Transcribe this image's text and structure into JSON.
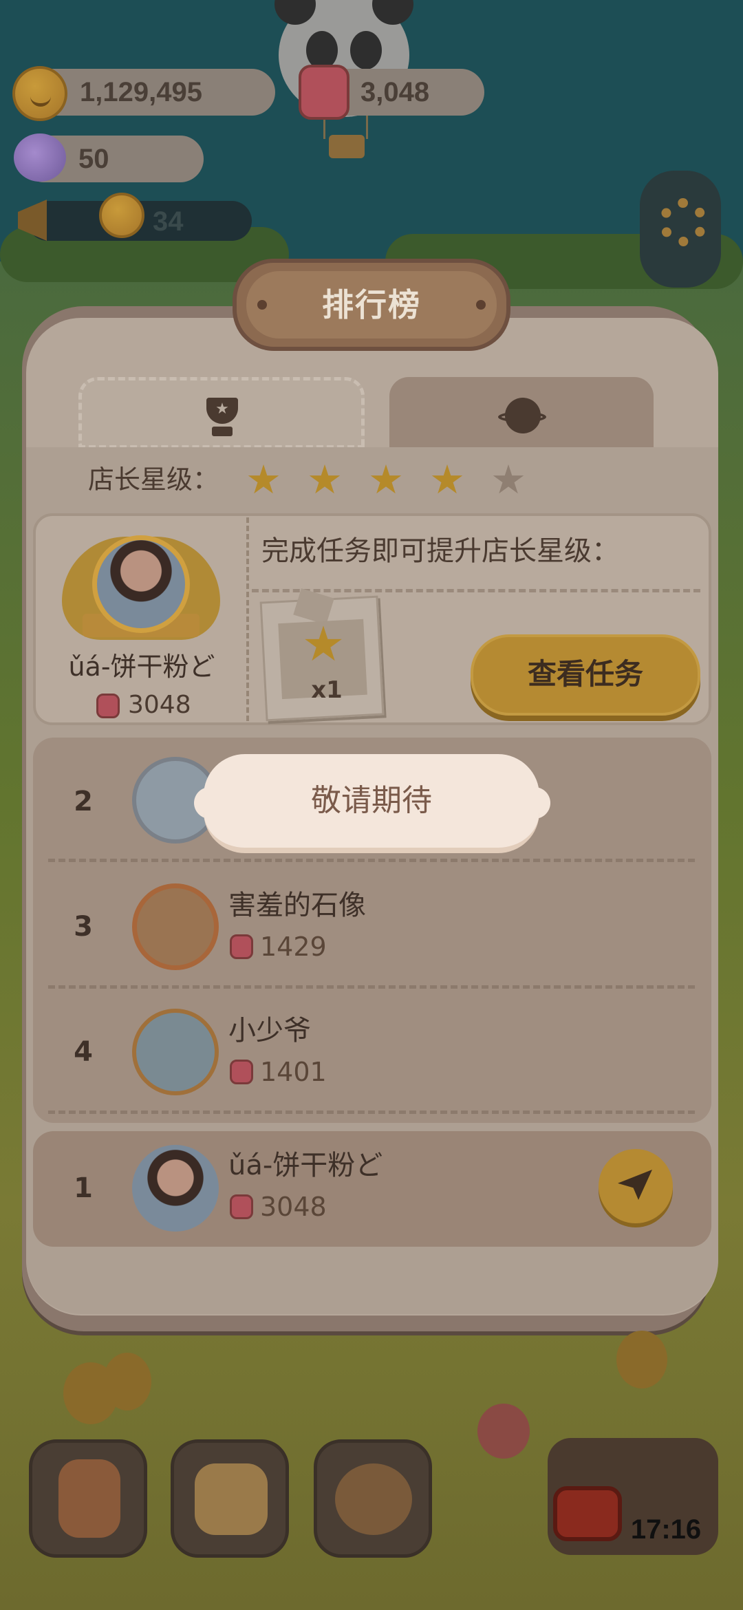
{
  "hud": {
    "coins": "1,129,495",
    "jam": "3,048",
    "candy": "50",
    "helpers": "34",
    "icons": [
      "cookie-coin-icon",
      "jam-jar-icon",
      "candy-icon",
      "megaphone-icon",
      "gear-icon"
    ]
  },
  "dialog": {
    "title": "排行榜",
    "tabs": [
      {
        "icon": "trophy-icon",
        "active": true
      },
      {
        "icon": "planet-icon",
        "active": false
      }
    ]
  },
  "stars": {
    "label": "店长星级：",
    "filled": 4,
    "total": 5
  },
  "profile": {
    "name": "ǔá-饼干粉ど",
    "score": "3048",
    "task_prompt": "完成任务即可提升店长星级：",
    "reward_count": "x1",
    "view_tasks_label": "查看任务"
  },
  "overlay": {
    "label": "敬请期待"
  },
  "ranking": [
    {
      "rank": "2",
      "name": "",
      "score": ""
    },
    {
      "rank": "3",
      "name": "害羞的石像",
      "score": "1429"
    },
    {
      "rank": "4",
      "name": "小少爷",
      "score": "1401"
    }
  ],
  "self_row": {
    "rank": "1",
    "name": "ǔá-饼干粉ど",
    "score": "3048",
    "action_icon": "paper-plane-icon"
  },
  "dock": {
    "timer": "17:16",
    "buttons": [
      "hotel-icon",
      "diary-icon",
      "cookie-plate-icon",
      "tv-icon"
    ]
  },
  "colors": {
    "accent_gold": "#b58a32",
    "overlay_bg": "#f4e6db",
    "panel": "#b5a79a"
  }
}
